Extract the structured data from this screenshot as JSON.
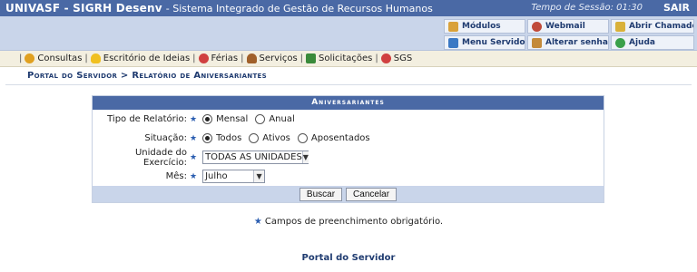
{
  "topbar": {
    "system_name": "UNIVASF - SIGRH Desenv",
    "subtitle": "- Sistema Integrado de Gestão de Recursos Humanos",
    "session_label": "Tempo de Sessão: 01:30",
    "logout": "SAIR"
  },
  "quick_links": [
    {
      "label": "Módulos",
      "icon": "modules-icon",
      "color": "#d9a13a"
    },
    {
      "label": "Webmail",
      "icon": "webmail-icon",
      "color": "#c04a3a"
    },
    {
      "label": "Abrir Chamado",
      "icon": "ticket-icon",
      "color": "#d9b13a"
    },
    {
      "label": "Menu Servidor",
      "icon": "menu-servidor-icon",
      "color": "#3a78c4"
    },
    {
      "label": "Alterar senha",
      "icon": "password-icon",
      "color": "#c48a3a"
    },
    {
      "label": "Ajuda",
      "icon": "help-icon",
      "color": "#3aa04a"
    }
  ],
  "menu": [
    {
      "label": "Consultas",
      "icon": "search-icon",
      "color": "#e0a020"
    },
    {
      "label": "Escritório de Ideias",
      "icon": "lightbulb-icon",
      "color": "#f0c020"
    },
    {
      "label": "Férias",
      "icon": "lifebuoy-icon",
      "color": "#d04040"
    },
    {
      "label": "Serviços",
      "icon": "user-icon",
      "color": "#a0602a"
    },
    {
      "label": "Solicitações",
      "icon": "document-icon",
      "color": "#3a8a3a"
    },
    {
      "label": "SGS",
      "icon": "lifebuoy-icon",
      "color": "#d04040"
    }
  ],
  "breadcrumb": "Portal do Servidor > Relatório de Aniversariantes",
  "form": {
    "caption": "Aniversariantes",
    "report_type_label": "Tipo de Relatório:",
    "report_type_options": [
      "Mensal",
      "Anual"
    ],
    "report_type_selected": "Mensal",
    "situation_label": "Situação:",
    "situation_options": [
      "Todos",
      "Ativos",
      "Aposentados"
    ],
    "situation_selected": "Todos",
    "unit_label": "Unidade do Exercício:",
    "unit_value": "TODAS AS UNIDADES",
    "month_label": "Mês:",
    "month_value": "Julho",
    "search_button": "Buscar",
    "cancel_button": "Cancelar"
  },
  "required_note": "Campos de preenchimento obrigatório.",
  "footer_link": "Portal do Servidor"
}
